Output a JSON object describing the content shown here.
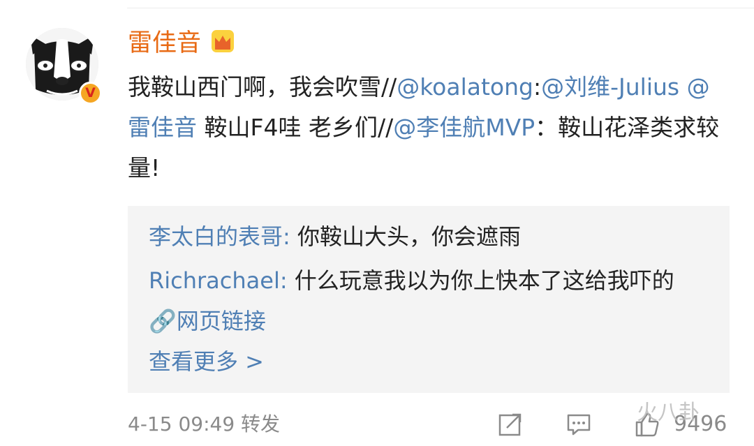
{
  "post": {
    "username": "雷佳音",
    "text": {
      "part1": "我鞍山西门啊，我会吹雪//",
      "mention1": "@koalatong",
      "colon1": ":",
      "mention2": "@刘维-Julius",
      "space1": " ",
      "mention3": "@雷佳音",
      "part2": " 鞍山F4哇 老乡们//",
      "mention4": "@李佳航MVP",
      "part3": "：鞍山花泽类求较量!"
    }
  },
  "comments": [
    {
      "author": "李太白的表哥:",
      "text": " 你鞍山大头，你会遮雨"
    },
    {
      "author": "Richrachael:",
      "text": " 什么玩意我以为你上快本了这给我吓的 ",
      "link_icon": "🔗",
      "link": "网页链接"
    }
  ],
  "view_more": "查看更多 >",
  "footer": {
    "time": "4-15 09:49  转发",
    "like_count": "9496"
  },
  "watermark": "火八卦",
  "icons": {
    "avatar": "bulldog-avatar-icon",
    "verified": "verified-v-icon",
    "crown": "crown-icon",
    "share": "share-icon",
    "comment": "comment-icon",
    "like": "like-icon",
    "link": "link-icon"
  },
  "colors": {
    "username": "#e86a14",
    "mention": "#4f7fb4",
    "repost_bg": "#f4f4f4",
    "muted": "#8a8a8a"
  }
}
